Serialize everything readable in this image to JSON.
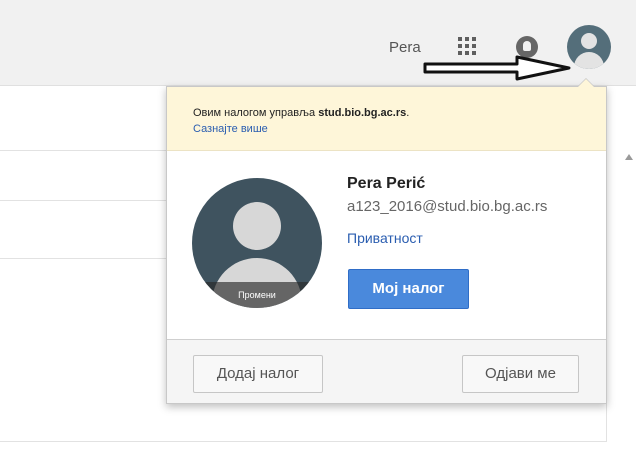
{
  "header": {
    "user_name": "Pera",
    "icons": {
      "apps": "apps-grid-icon",
      "notifications": "notifications-icon",
      "account": "account-avatar-icon"
    }
  },
  "popup": {
    "managed_prefix": "Овим налогом управља ",
    "managed_domain": "stud.bio.bg.ac.rs",
    "managed_suffix": ".",
    "learn_more": "Сазнајте више",
    "change_photo": "Промени",
    "account_name": "Pera Perić",
    "account_email": "a123_2016@stud.bio.bg.ac.rs",
    "privacy": "Приватност",
    "my_account": "Мој налог",
    "add_account": "Додај налог",
    "sign_out": "Одјави ме"
  },
  "colors": {
    "managed_banner": "#fef6d9",
    "primary_button": "#4a89dc",
    "link": "#2a5db0",
    "avatar_bg": "#3f535f"
  }
}
